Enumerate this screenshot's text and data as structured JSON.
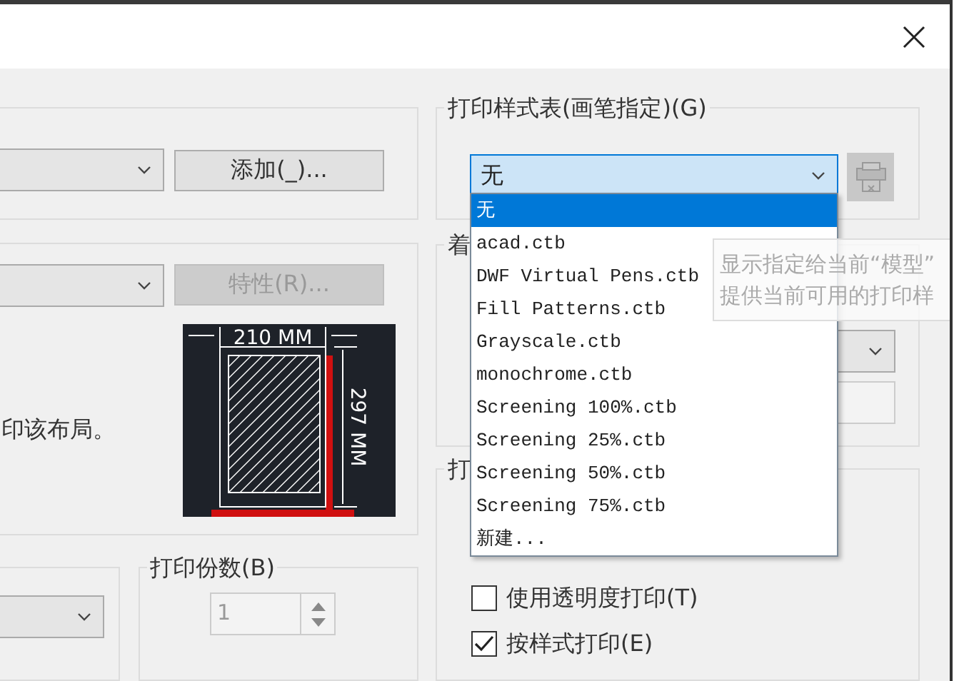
{
  "device_group": {
    "add_button": "添加(_)..."
  },
  "paper_group": {
    "properties_button": {
      "label": "特性(R)...",
      "disabled": true
    },
    "note": "印该布局。",
    "preview": {
      "width_label": "210 MM",
      "height_label": "297 MM"
    }
  },
  "copies_group": {
    "title": "打印份数(B)",
    "value": "1"
  },
  "plot_style_group": {
    "title": "打印样式表(画笔指定)(G)",
    "value": "无",
    "expanded": true,
    "options": [
      {
        "label": "无",
        "selected": true
      },
      {
        "label": "acad.ctb",
        "selected": false
      },
      {
        "label": "DWF Virtual Pens.ctb",
        "selected": false
      },
      {
        "label": "Fill Patterns.ctb",
        "selected": false
      },
      {
        "label": "Grayscale.ctb",
        "selected": false
      },
      {
        "label": "monochrome.ctb",
        "selected": false
      },
      {
        "label": "Screening 100%.ctb",
        "selected": false
      },
      {
        "label": "Screening 25%.ctb",
        "selected": false
      },
      {
        "label": "Screening 50%.ctb",
        "selected": false
      },
      {
        "label": "Screening 75%.ctb",
        "selected": false
      },
      {
        "label": "新建...",
        "selected": false
      }
    ]
  },
  "shaded_group": {
    "title": "着"
  },
  "tooltip": {
    "lines": [
      "显示指定给当前“模型”",
      "提供当前可用的打印样"
    ]
  },
  "options_group": {
    "title": "打",
    "checkboxes": [
      {
        "label": "使用透明度打印(T)",
        "checked": false
      },
      {
        "label": "按样式打印(E)",
        "checked": true
      }
    ]
  }
}
